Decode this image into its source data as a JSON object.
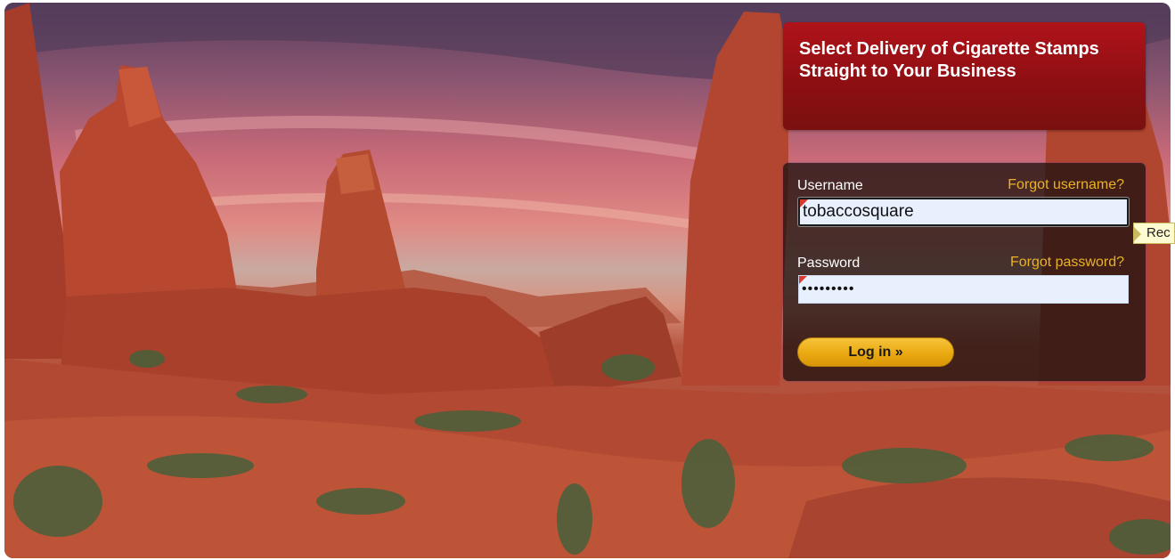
{
  "promo": {
    "title": "Select Delivery of Cigarette Stamps Straight to Your Business"
  },
  "login": {
    "username_label": "Username",
    "forgot_username": "Forgot username?",
    "username_value": "tobaccosquare",
    "password_label": "Password",
    "forgot_password": "Forgot password?",
    "password_value": "•••••••••",
    "login_button": "Log in »"
  },
  "tooltip": {
    "text": "Rec"
  },
  "colors": {
    "title_box": "#9b1116",
    "link": "#e9b224",
    "button": "#eaa911",
    "field_background": "#e8f0fe"
  }
}
